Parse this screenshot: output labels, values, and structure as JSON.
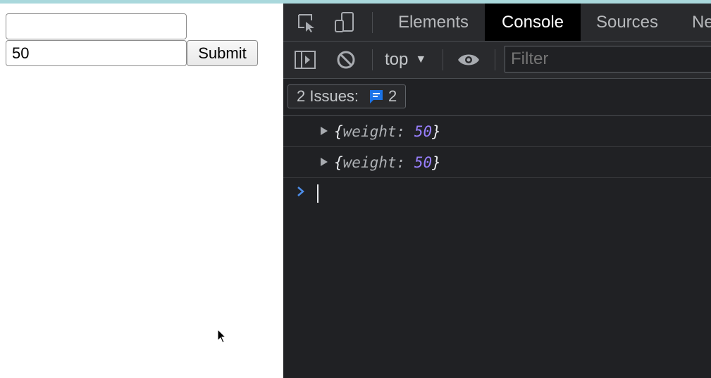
{
  "page": {
    "input_top": {
      "value": "",
      "placeholder": ""
    },
    "input_bottom": {
      "value": "50",
      "placeholder": ""
    },
    "submit_label": "Submit"
  },
  "devtools": {
    "tabs": [
      {
        "label": "Elements",
        "active": false
      },
      {
        "label": "Console",
        "active": true
      },
      {
        "label": "Sources",
        "active": false
      },
      {
        "label": "Ne",
        "active": false
      }
    ],
    "toolbar": {
      "context": "top",
      "filter_placeholder": "Filter"
    },
    "issues": {
      "label": "2 Issues:",
      "count": "2"
    },
    "console_lines": [
      {
        "open": "{",
        "key": "weight",
        "colon": ":",
        "value": "50",
        "close": "}"
      },
      {
        "open": "{",
        "key": "weight",
        "colon": ":",
        "value": "50",
        "close": "}"
      }
    ],
    "colors": {
      "background": "#202124",
      "active_tab": "#000000",
      "accent_blue": "#1a73e8",
      "number": "#9980ff"
    }
  }
}
